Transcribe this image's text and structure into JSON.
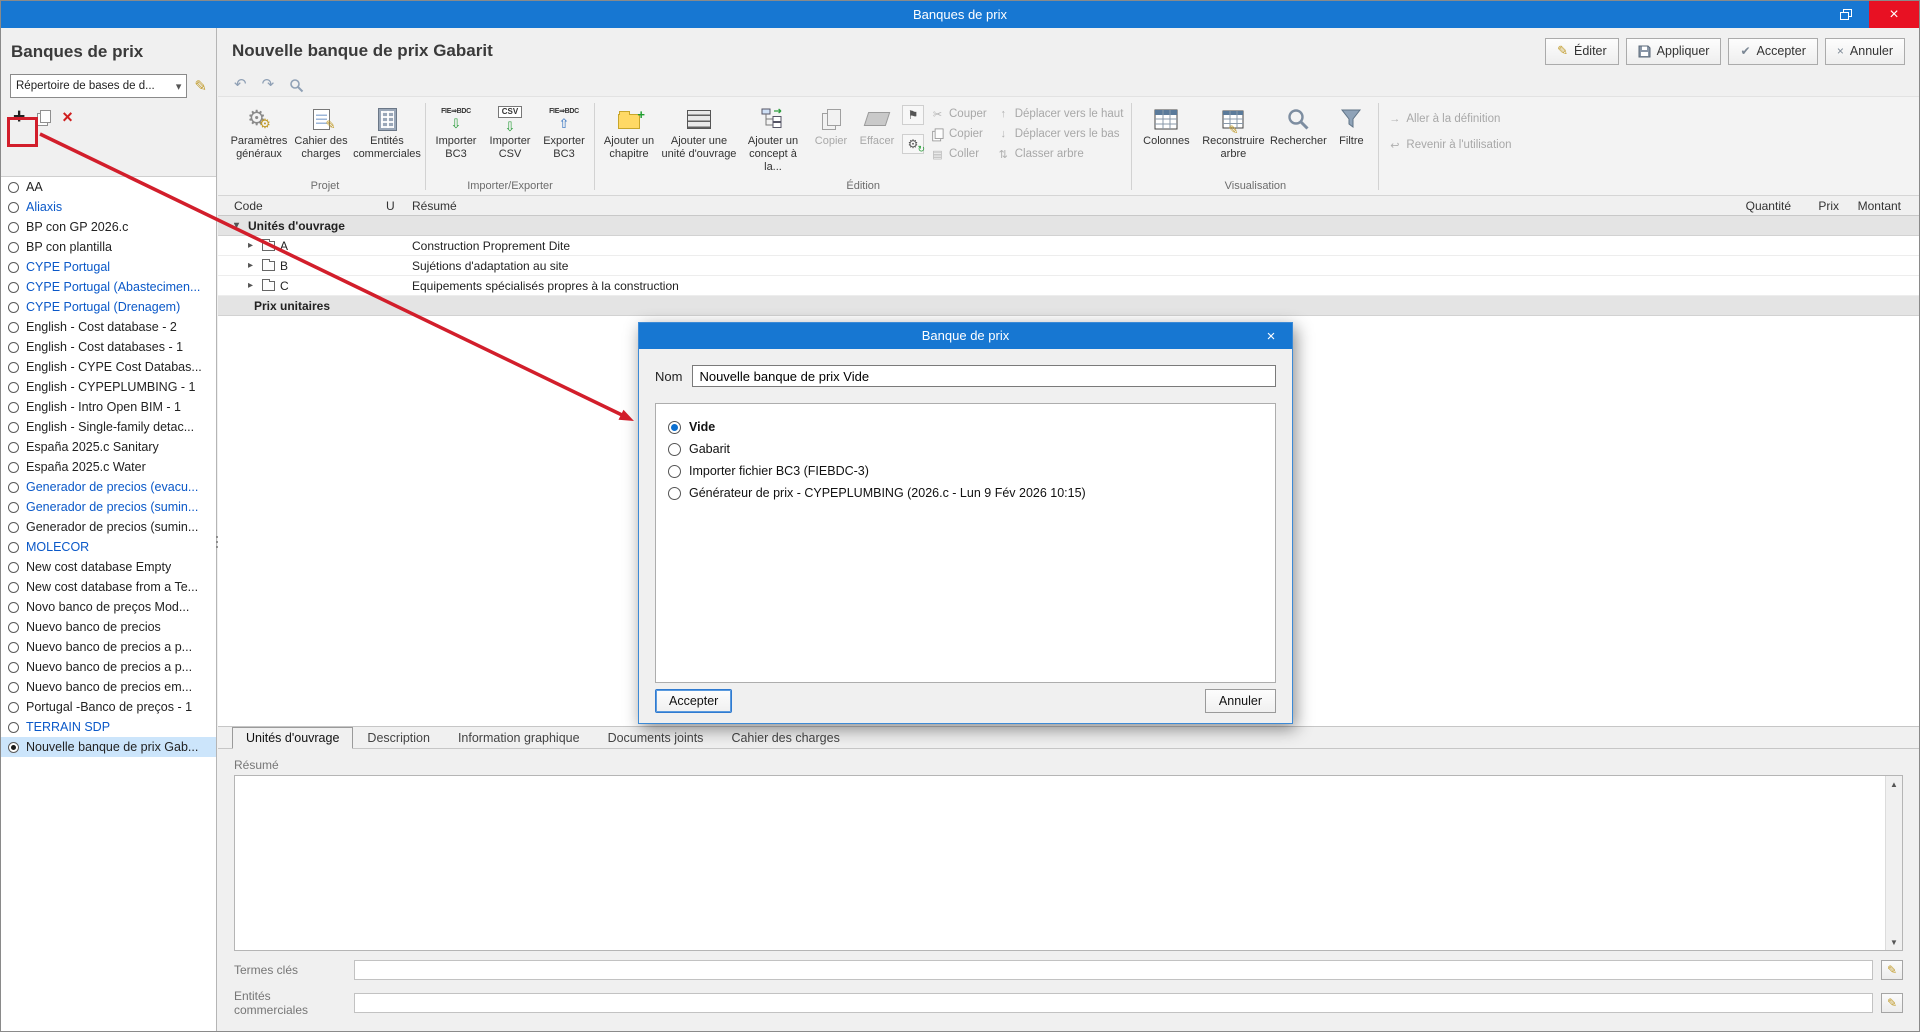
{
  "window": {
    "title": "Banques de prix"
  },
  "icons": {
    "undo": "↶",
    "redo": "↷",
    "pencil": "✎",
    "check": "✔",
    "cross": "×",
    "scissors": "✂",
    "up": "↑",
    "down": "↓",
    "sort": "⇅",
    "flag": "⚑",
    "gear": "⚙",
    "plus": "+",
    "chevron_down": "▾",
    "expand": "▾",
    "chevron_right": "▸",
    "arrow_go": "→",
    "arrow_back": "↩",
    "import_arrow": "⇩",
    "export_arrow": "⇧",
    "scroll_up": "▲",
    "scroll_down": "▼",
    "fie_bdc": "FIE⇒BDC",
    "csv": "CSV"
  },
  "annotation": {
    "color": "#d21e2b"
  },
  "sidebar": {
    "title": "Banques de prix",
    "repo_value": "Répertoire de bases de d...",
    "items": [
      {
        "label": "AA"
      },
      {
        "label": "Aliaxis",
        "blue": true
      },
      {
        "label": "BP con GP 2026.c"
      },
      {
        "label": "BP con plantilla"
      },
      {
        "label": "CYPE Portugal",
        "blue": true
      },
      {
        "label": "CYPE Portugal (Abastecimen...",
        "blue": true
      },
      {
        "label": "CYPE Portugal (Drenagem)",
        "blue": true
      },
      {
        "label": "English - Cost database - 2"
      },
      {
        "label": "English - Cost databases - 1"
      },
      {
        "label": "English - CYPE Cost Databas..."
      },
      {
        "label": "English - CYPEPLUMBING - 1"
      },
      {
        "label": "English - Intro Open BIM - 1"
      },
      {
        "label": "English - Single-family detac..."
      },
      {
        "label": "España 2025.c Sanitary"
      },
      {
        "label": "España 2025.c Water"
      },
      {
        "label": "Generador de precios (evacu...",
        "blue": true
      },
      {
        "label": "Generador de precios (sumin...",
        "blue": true
      },
      {
        "label": "Generador de precios (sumin..."
      },
      {
        "label": "MOLECOR",
        "blue": true
      },
      {
        "label": "New cost database Empty"
      },
      {
        "label": "New cost database from a Te..."
      },
      {
        "label": "Novo banco de preços Mod..."
      },
      {
        "label": "Nuevo banco de precios"
      },
      {
        "label": "Nuevo banco de precios a p..."
      },
      {
        "label": "Nuevo banco de precios a p..."
      },
      {
        "label": "Nuevo banco de precios em..."
      },
      {
        "label": "Portugal -Banco de preços - 1"
      },
      {
        "label": "TERRAIN SDP",
        "blue": true
      },
      {
        "label": "Nouvelle banque de prix Gab...",
        "selected": true
      }
    ]
  },
  "main": {
    "title": "Nouvelle banque de prix Gabarit",
    "actions": {
      "edit": "Éditer",
      "apply": "Appliquer",
      "accept": "Accepter",
      "cancel": "Annuler"
    }
  },
  "ribbon": {
    "g_projet": "Projet",
    "g_import": "Importer/Exporter",
    "g_edition": "Édition",
    "g_visu": "Visualisation",
    "params": "Paramètres généraux",
    "cahier": "Cahier des charges",
    "entites": "Entités commerciales",
    "import_bc3": "Importer BC3",
    "import_csv": "Importer CSV",
    "export_bc3": "Exporter BC3",
    "add_chapitre": "Ajouter un chapitre",
    "add_unite": "Ajouter une unité d'ouvrage",
    "add_concept": "Ajouter un concept à la...",
    "copier_big": "Copier",
    "effacer": "Effacer",
    "couper": "Couper",
    "copier": "Copier",
    "coller": "Coller",
    "monter": "Déplacer vers le haut",
    "descendre": "Déplacer vers le bas",
    "classer": "Classer arbre",
    "colonnes": "Colonnes",
    "reconstruire": "Reconstruire arbre",
    "rechercher": "Rechercher",
    "filtre": "Filtre",
    "aller_def": "Aller à la définition",
    "revenir_util": "Revenir à l'utilisation"
  },
  "table": {
    "columns": [
      "Code",
      "U",
      "Résumé",
      "Quantité",
      "Prix",
      "Montant"
    ],
    "band1": "Unités d'ouvrage",
    "band2": "Prix unitaires",
    "rows": [
      {
        "code": "A",
        "summary": "Construction Proprement Dite"
      },
      {
        "code": "B",
        "summary": "Sujétions d'adaptation au site"
      },
      {
        "code": "C",
        "summary": "Equipements spécialisés propres à la construction"
      }
    ]
  },
  "dialog": {
    "title": "Banque de prix",
    "name_label": "Nom",
    "name_value": "Nouvelle banque de prix Vide",
    "options": [
      {
        "label": "Vide",
        "selected": true,
        "bold": true
      },
      {
        "label": "Gabarit"
      },
      {
        "label": "Importer fichier BC3 (FIEBDC-3)"
      },
      {
        "label": "Générateur de prix - CYPEPLUMBING (2026.c - Lun  9 Fév 2026  10:15)"
      }
    ],
    "accept": "Accepter",
    "cancel": "Annuler"
  },
  "bottom": {
    "tabs": [
      {
        "label": "Unités d'ouvrage",
        "active": true
      },
      {
        "label": "Description"
      },
      {
        "label": "Information graphique"
      },
      {
        "label": "Documents joints"
      },
      {
        "label": "Cahier des charges"
      }
    ],
    "resume_label": "Résumé",
    "terms_label": "Termes clés",
    "entities_label": "Entités commerciales"
  }
}
